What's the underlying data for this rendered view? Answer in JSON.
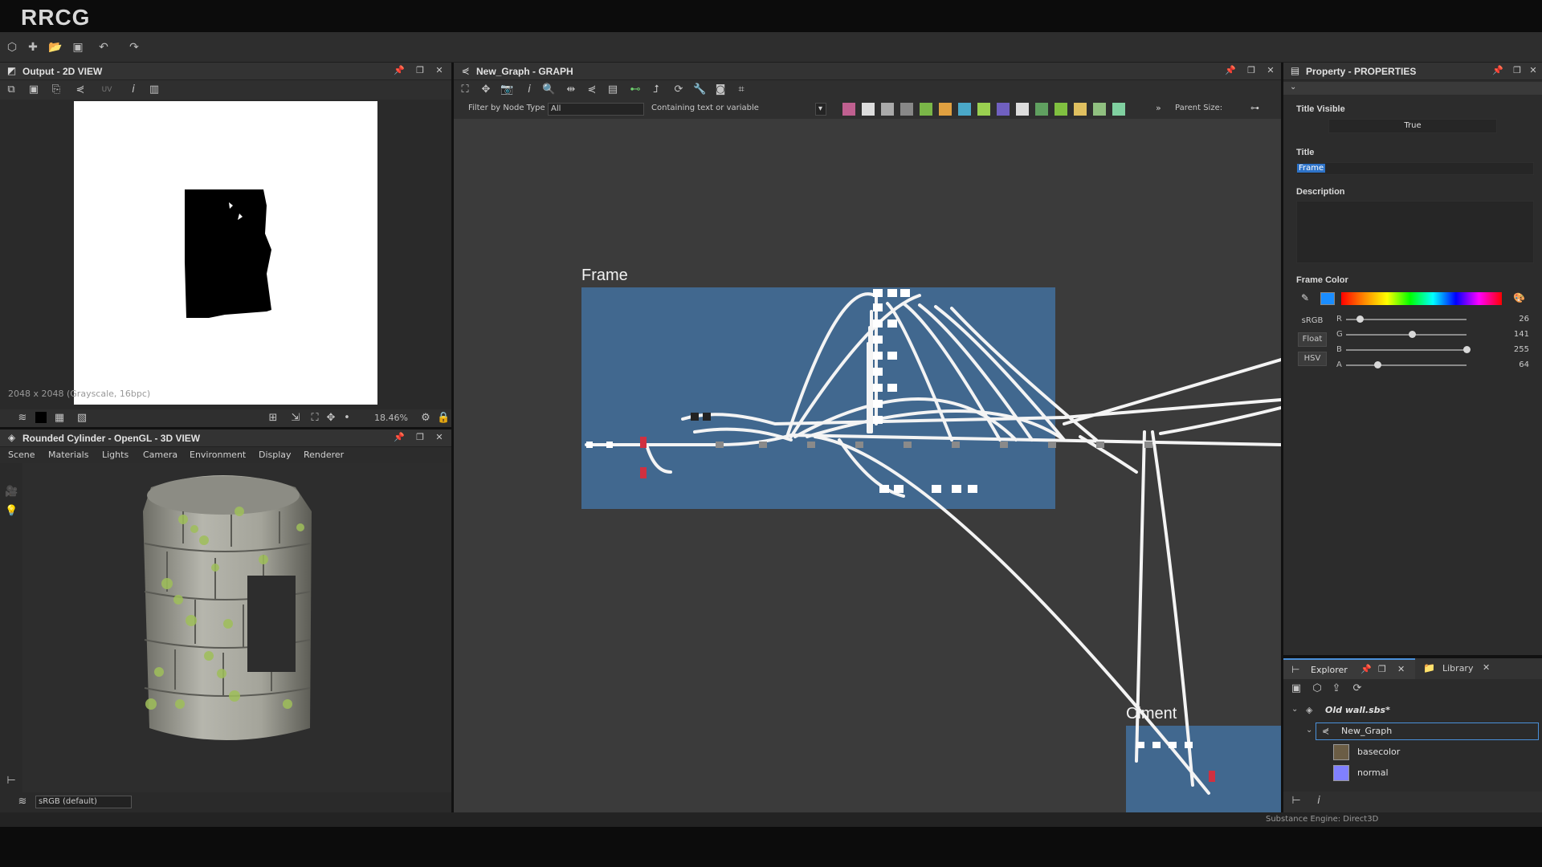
{
  "app": {
    "brand": "RRCG"
  },
  "output_panel": {
    "title": "Output - 2D VIEW",
    "image_info": "2048 x 2048 (Grayscale, 16bpc)",
    "zoom": "18.46%",
    "uv_label": "UV"
  },
  "view3d_panel": {
    "title": "Rounded Cylinder - OpenGL - 3D VIEW",
    "menu": [
      "Scene",
      "Materials",
      "Lights",
      "Camera",
      "Environment",
      "Display",
      "Renderer"
    ],
    "colorspace": "sRGB (default)"
  },
  "graph_panel": {
    "title": "New_Graph - GRAPH",
    "filter_label": "Filter by Node Type",
    "filter_value": "All",
    "search_placeholder": "Containing text or variable",
    "parent_size_label": "Parent Size:",
    "frames": [
      {
        "title": "Frame",
        "color": "#41688f"
      },
      {
        "title": "Ciment",
        "color": "#41688f"
      }
    ]
  },
  "properties_panel": {
    "title": "Property - PROPERTIES",
    "title_visible_label": "Title Visible",
    "title_visible_value": "True",
    "title_label": "Title",
    "title_value": "Frame",
    "description_label": "Description",
    "frame_color_label": "Frame Color",
    "modes": [
      "sRGB",
      "Float",
      "HSV"
    ],
    "channels": [
      {
        "name": "R",
        "value": "26",
        "fraction": 0.1
      },
      {
        "name": "G",
        "value": "141",
        "fraction": 0.55
      },
      {
        "name": "B",
        "value": "255",
        "fraction": 1.0
      },
      {
        "name": "A",
        "value": "64",
        "fraction": 0.25
      }
    ],
    "swatch_color": "#1a8dff"
  },
  "explorer_panel": {
    "tab_explorer": "Explorer",
    "tab_library": "Library",
    "tree": {
      "package": "Old wall.sbs*",
      "graph": "New_Graph",
      "outputs": [
        "basecolor",
        "normal"
      ]
    }
  },
  "status": {
    "engine": "Substance Engine: Direct3D"
  }
}
